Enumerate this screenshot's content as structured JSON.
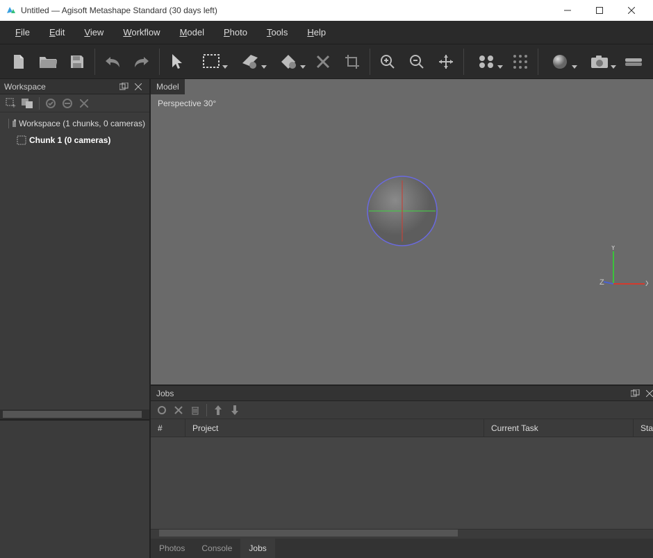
{
  "titlebar": {
    "title": "Untitled — Agisoft Metashape Standard (30 days left)"
  },
  "menubar": {
    "items": [
      {
        "label": "File",
        "u": "F"
      },
      {
        "label": "Edit",
        "u": "E"
      },
      {
        "label": "View",
        "u": "V"
      },
      {
        "label": "Workflow",
        "u": "W"
      },
      {
        "label": "Model",
        "u": "M"
      },
      {
        "label": "Photo",
        "u": "P"
      },
      {
        "label": "Tools",
        "u": "T"
      },
      {
        "label": "Help",
        "u": "H"
      }
    ]
  },
  "workspace": {
    "title": "Workspace",
    "root": "Workspace (1 chunks, 0 cameras)",
    "child": "Chunk 1 (0 cameras)"
  },
  "viewport": {
    "title": "Model",
    "projection": "Perspective 30°",
    "axes": {
      "x": "X",
      "y": "Y",
      "z": "Z"
    }
  },
  "jobs": {
    "title": "Jobs",
    "columns": {
      "num": "#",
      "project": "Project",
      "task": "Current Task",
      "status": "Stat"
    }
  },
  "tabs": {
    "items": [
      {
        "label": "Photos",
        "active": false
      },
      {
        "label": "Console",
        "active": false
      },
      {
        "label": "Jobs",
        "active": true
      }
    ]
  }
}
